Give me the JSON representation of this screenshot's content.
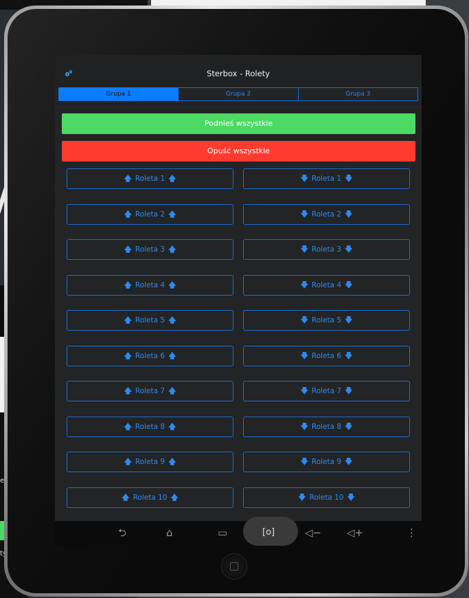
{
  "background": {
    "fragment_text_1": "et",
    "fragment_text_2": "ty",
    "big_glyph": "/"
  },
  "app": {
    "title": "Sterbox - Rolety",
    "settings_icon": "gear-icon",
    "accent_color": "#0a7cff",
    "tabs": [
      {
        "label": "Grupa 1",
        "active": true
      },
      {
        "label": "Grupa 2",
        "active": false
      },
      {
        "label": "Grupa 3",
        "active": false
      }
    ],
    "raise_all_label": "Podnieś wszystkie",
    "raise_all_color": "#4cd964",
    "lower_all_label": "Opuść wszystkie",
    "lower_all_color": "#ff3b30",
    "rows": [
      {
        "up": "Roleta 1",
        "down": "Roleta 1"
      },
      {
        "up": "Roleta 2",
        "down": "Roleta 2"
      },
      {
        "up": "Roleta 3",
        "down": "Roleta 3"
      },
      {
        "up": "Roleta 4",
        "down": "Roleta 4"
      },
      {
        "up": "Roleta 5",
        "down": "Roleta 5"
      },
      {
        "up": "Roleta 6",
        "down": "Roleta 6"
      },
      {
        "up": "Roleta 7",
        "down": "Roleta 7"
      },
      {
        "up": "Roleta 8",
        "down": "Roleta 8"
      },
      {
        "up": "Roleta 9",
        "down": "Roleta 9"
      },
      {
        "up": "Roleta 10",
        "down": "Roleta 10"
      }
    ]
  },
  "navbar": {
    "back_icon": "⮌",
    "home_icon": "⌂",
    "recent_icon": "▭",
    "screenshot_icon": "[o]",
    "vol_down_icon": "◁−",
    "vol_up_icon": "◁+",
    "menu_icon": "⋮"
  }
}
